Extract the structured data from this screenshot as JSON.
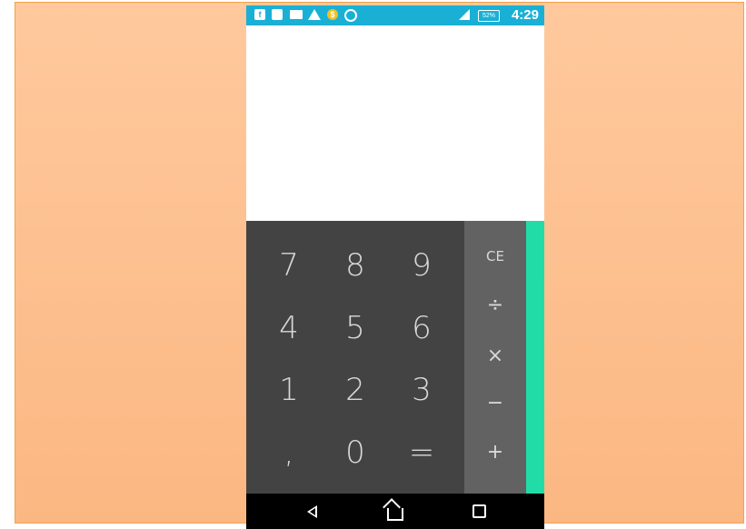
{
  "status_bar": {
    "icons": [
      "facebook-icon",
      "gallery-icon",
      "mail-icon",
      "drive-icon",
      "coin-icon",
      "soccer-icon",
      "signal-icon",
      "battery-icon"
    ],
    "battery": "52%",
    "time": "4:29"
  },
  "display": {
    "value": ""
  },
  "keypad": {
    "rows": [
      [
        "7",
        "8",
        "9"
      ],
      [
        "4",
        "5",
        "6"
      ],
      [
        "1",
        "2",
        "3"
      ],
      [
        ",",
        "0",
        "="
      ]
    ]
  },
  "operators": {
    "ce": "CE",
    "divide": "÷",
    "multiply": "×",
    "minus": "−",
    "plus": "+"
  },
  "nav_bar": {
    "buttons": [
      "back-icon",
      "home-icon",
      "recents-icon"
    ]
  },
  "colors": {
    "status_bar": "#1ab0d6",
    "keypad": "#434343",
    "operators": "#626262",
    "accent": "#22dca7",
    "background_top": "#ffc99d",
    "background_bottom": "#fbb782"
  }
}
